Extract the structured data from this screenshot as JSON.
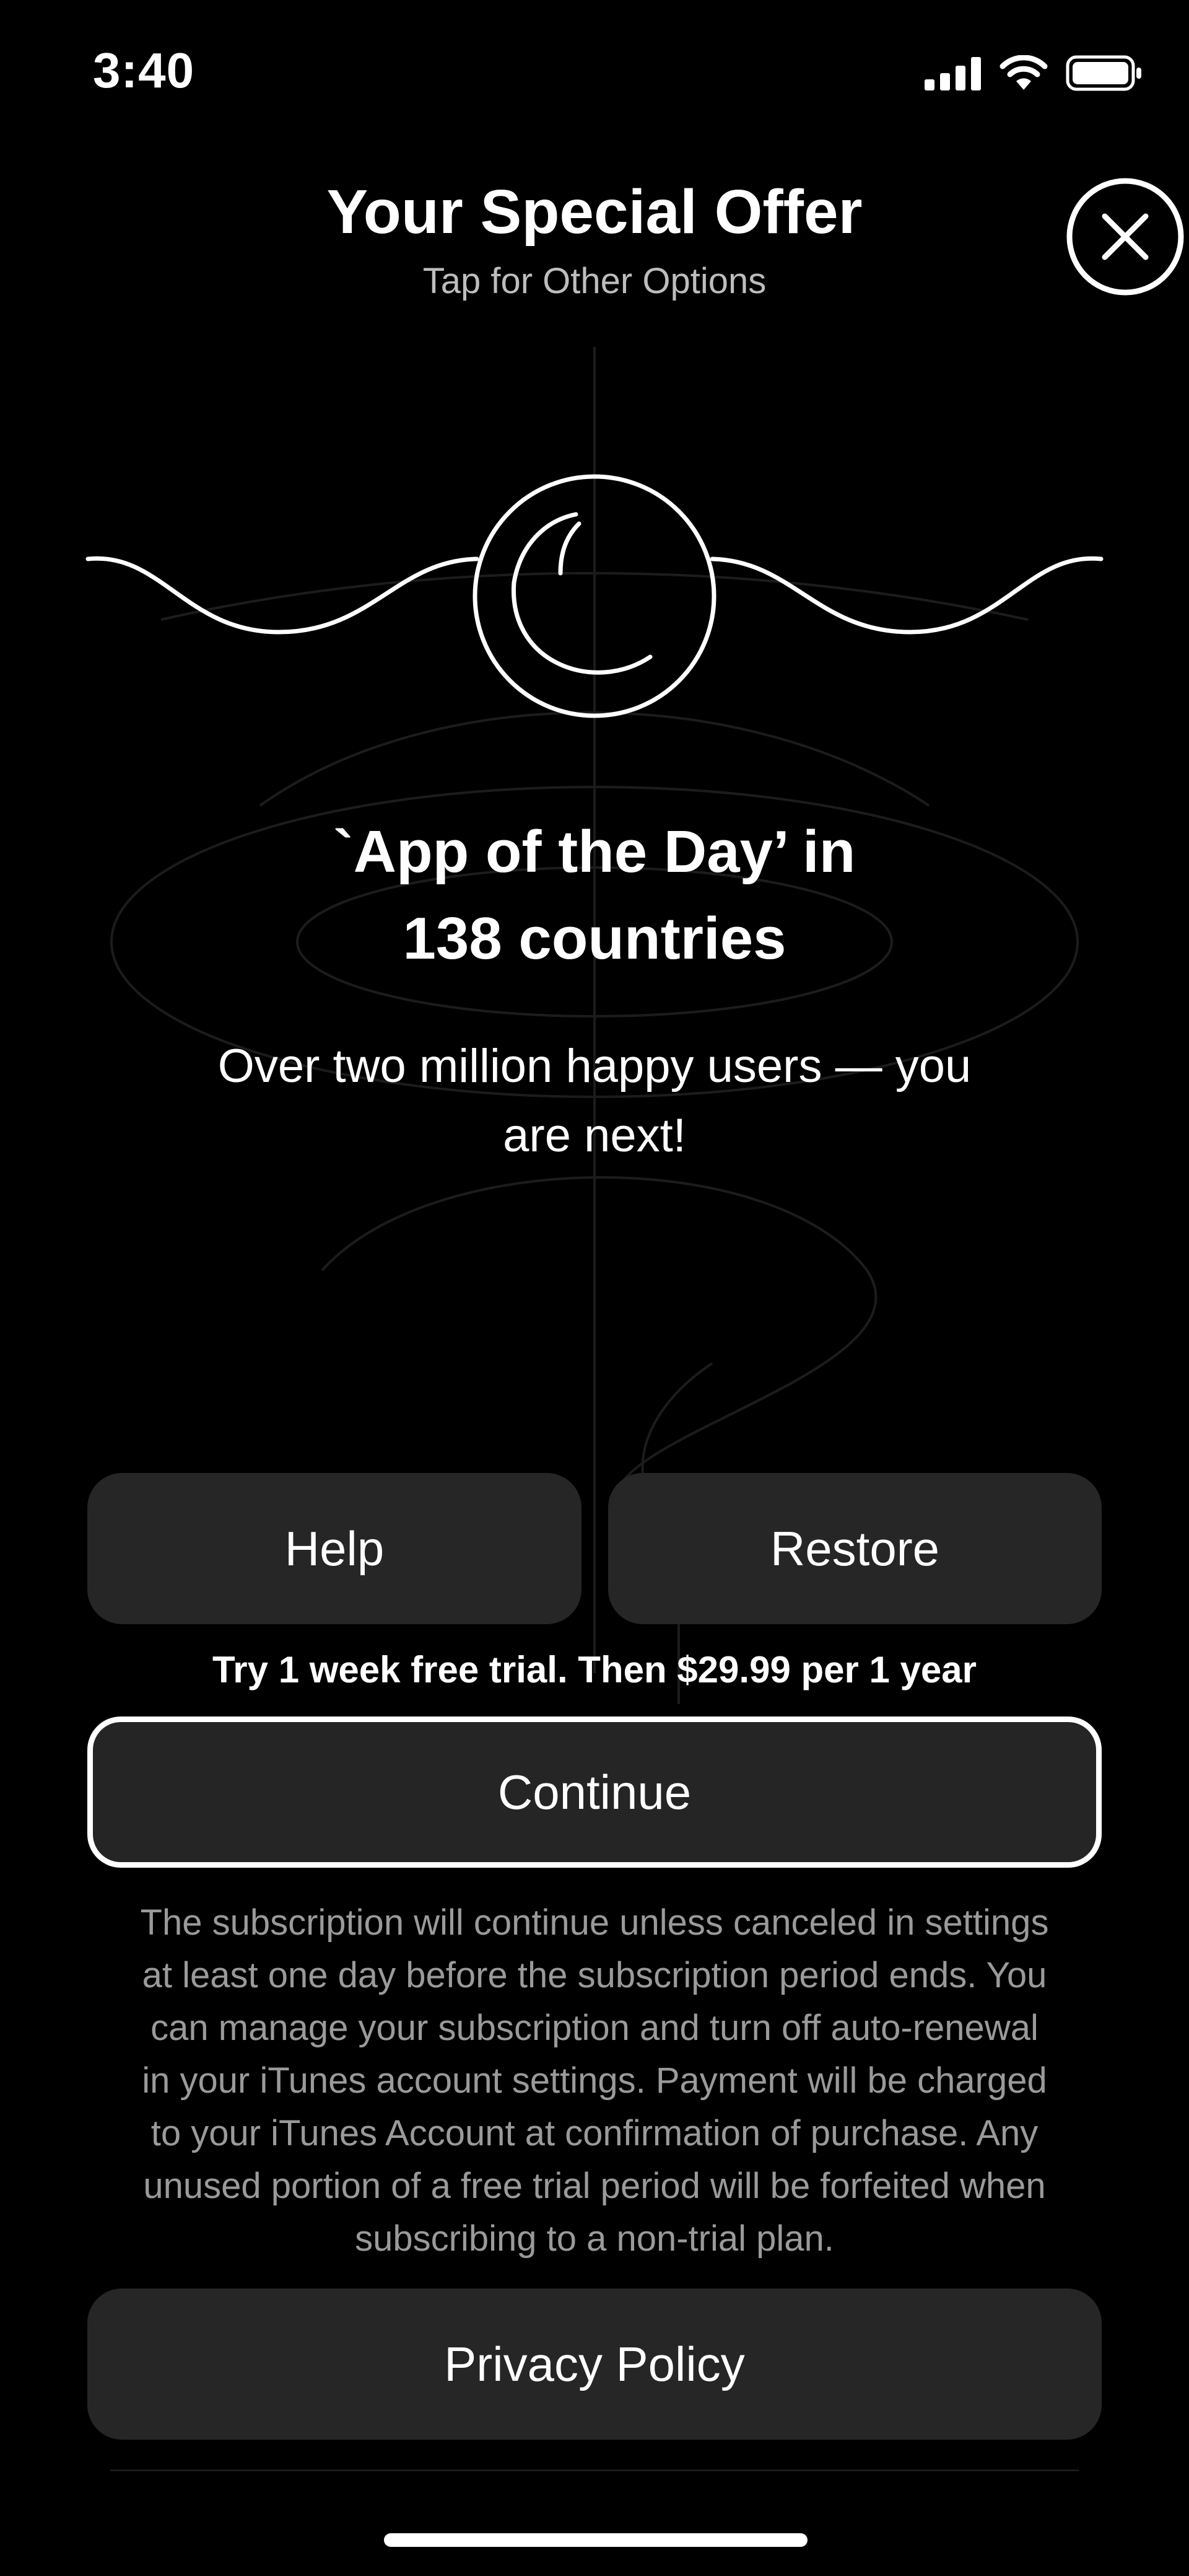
{
  "status_bar": {
    "time": "3:40",
    "icons": [
      "signal-icon",
      "wifi-icon",
      "battery-icon"
    ]
  },
  "header": {
    "title": "Your Special Offer",
    "subtitle": "Tap for Other Options",
    "close_icon": "close-icon"
  },
  "hero": {
    "icon": "moon-icon",
    "headline_line1": "`App of the Day’ in",
    "headline_line2": "138 countries",
    "subhead_line1": "Over two million happy users — you",
    "subhead_line2": "are next!"
  },
  "actions": {
    "help_label": "Help",
    "restore_label": "Restore",
    "trial_text": "Try 1 week free trial. Then $29.99 per 1 year",
    "continue_label": "Continue",
    "privacy_label": "Privacy Policy"
  },
  "legal": {
    "lines": [
      "The subscription will continue unless canceled in settings",
      "at least one day before the subscription period ends. You",
      "can manage your subscription and turn off auto-renewal",
      "in your iTunes account settings. Payment will be charged",
      "to your iTunes Account at confirmation of purchase. Any",
      "unused portion of a free trial period will be forfeited when",
      "subscribing to a non-trial plan."
    ]
  },
  "colors": {
    "background": "#000000",
    "button_fill": "#262626",
    "legal_text": "#9a9a9a",
    "accent": "#ffffff"
  }
}
